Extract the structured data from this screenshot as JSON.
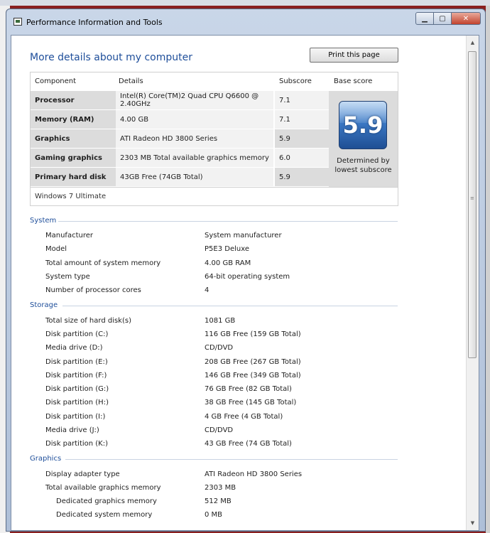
{
  "window": {
    "title": "Performance Information and Tools"
  },
  "page": {
    "heading": "More details about my computer",
    "print_label": "Print this page"
  },
  "score_table": {
    "headers": {
      "component": "Component",
      "details": "Details",
      "subscore": "Subscore",
      "base": "Base score"
    },
    "rows": [
      {
        "component": "Processor",
        "details": "Intel(R) Core(TM)2 Quad CPU Q6600 @ 2.40GHz",
        "subscore": "7.1"
      },
      {
        "component": "Memory (RAM)",
        "details": "4.00 GB",
        "subscore": "7.1"
      },
      {
        "component": "Graphics",
        "details": "ATI Radeon HD 3800 Series",
        "subscore": "5.9"
      },
      {
        "component": "Gaming graphics",
        "details": "2303 MB Total available graphics memory",
        "subscore": "6.0"
      },
      {
        "component": "Primary hard disk",
        "details": "43GB Free (74GB Total)",
        "subscore": "5.9"
      }
    ],
    "base_score": "5.9",
    "determined_1": "Determined by",
    "determined_2": "lowest subscore",
    "os": "Windows 7 Ultimate"
  },
  "system": {
    "title": "System",
    "items": [
      {
        "label": "Manufacturer",
        "value": "System manufacturer"
      },
      {
        "label": "Model",
        "value": "P5E3 Deluxe"
      },
      {
        "label": "Total amount of system memory",
        "value": "4.00 GB RAM"
      },
      {
        "label": "System type",
        "value": "64-bit operating system"
      },
      {
        "label": "Number of processor cores",
        "value": "4"
      }
    ]
  },
  "storage": {
    "title": "Storage",
    "items": [
      {
        "label": "Total size of hard disk(s)",
        "value": "1081 GB"
      },
      {
        "label": "Disk partition (C:)",
        "value": "116 GB Free (159 GB Total)"
      },
      {
        "label": "Media drive (D:)",
        "value": "CD/DVD"
      },
      {
        "label": "Disk partition (E:)",
        "value": "208 GB Free (267 GB Total)"
      },
      {
        "label": "Disk partition (F:)",
        "value": "146 GB Free (349 GB Total)"
      },
      {
        "label": "Disk partition (G:)",
        "value": "76 GB Free (82 GB Total)"
      },
      {
        "label": "Disk partition (H:)",
        "value": "38 GB Free (145 GB Total)"
      },
      {
        "label": "Disk partition (I:)",
        "value": "4 GB Free (4 GB Total)"
      },
      {
        "label": "Media drive (J:)",
        "value": "CD/DVD"
      },
      {
        "label": "Disk partition (K:)",
        "value": "43 GB Free (74 GB Total)"
      }
    ]
  },
  "graphics": {
    "title": "Graphics",
    "items": [
      {
        "label": "Display adapter type",
        "value": "ATI Radeon HD 3800 Series"
      },
      {
        "label": "Total available graphics memory",
        "value": "2303 MB"
      },
      {
        "label": "Dedicated graphics memory",
        "value": "512 MB"
      },
      {
        "label": "Dedicated system memory",
        "value": "0 MB"
      }
    ]
  },
  "icons": {
    "app": "performance-tools-icon",
    "minimize": "minimize-icon",
    "maximize": "maximize-icon",
    "close": "close-icon",
    "scroll_up": "scroll-up-arrow-icon",
    "scroll_down": "scroll-down-arrow-icon"
  },
  "colors": {
    "heading": "#1e4e9a",
    "badge": "#3b78c4",
    "frame": "#aebfd8",
    "background": "#8a1f1f"
  }
}
